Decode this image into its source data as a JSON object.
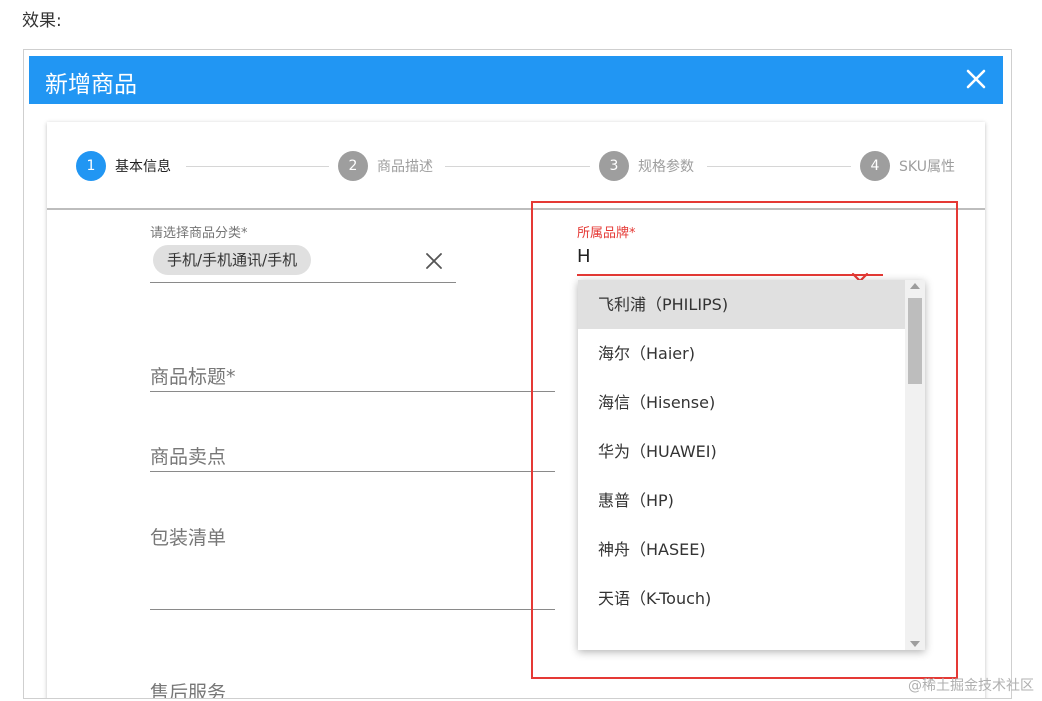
{
  "caption": "效果:",
  "dialog": {
    "title": "新增商品"
  },
  "steps": [
    {
      "number": "1",
      "label": "基本信息",
      "active": true
    },
    {
      "number": "2",
      "label": "商品描述",
      "active": false
    },
    {
      "number": "3",
      "label": "规格参数",
      "active": false
    },
    {
      "number": "4",
      "label": "SKU属性",
      "active": false
    }
  ],
  "category": {
    "label": "请选择商品分类*",
    "chip": "手机/手机通讯/手机"
  },
  "fields": {
    "title_placeholder": "商品标题*",
    "selling_point_placeholder": "商品卖点",
    "packing_list_placeholder": "包装清单",
    "after_sale_placeholder": "售后服务"
  },
  "brand": {
    "label": "所属品牌*",
    "value": "H",
    "options": [
      "飞利浦（PHILIPS)",
      "海尔（Haier)",
      "海信（Hisense)",
      "华为（HUAWEI)",
      "惠普（HP)",
      "神舟（HASEE)",
      "天语（K-Touch)"
    ]
  },
  "watermark": "@稀土掘金技术社区",
  "colors": {
    "primary": "#2196f3",
    "error": "#e53935"
  }
}
